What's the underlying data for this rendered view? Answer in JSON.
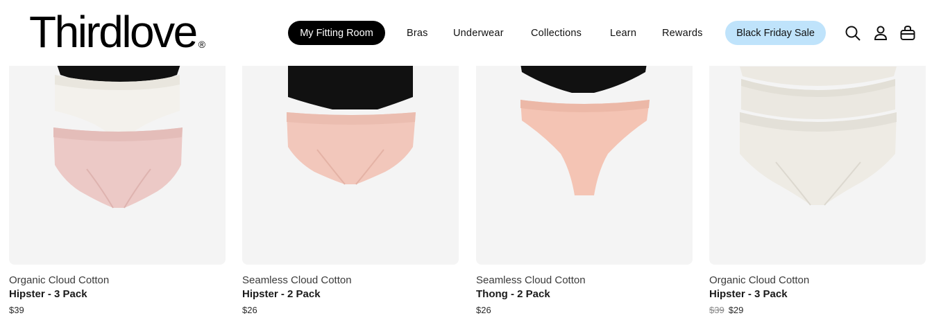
{
  "header": {
    "logo": "Thirdlove",
    "logo_mark": "®",
    "nav": {
      "fitting_room": "My Fitting Room",
      "bras": "Bras",
      "underwear": "Underwear",
      "collections": "Collections",
      "learn": "Learn",
      "rewards": "Rewards",
      "black_friday": "Black Friday Sale"
    },
    "icons": [
      "search-icon",
      "account-icon",
      "cart-icon"
    ]
  },
  "products": [
    {
      "collection": "Organic Cloud Cotton",
      "name": "Hipster - 3 Pack",
      "price": "$39",
      "colors": [
        "#111111",
        "#f3f1ec",
        "#ecc9c6"
      ]
    },
    {
      "collection": "Seamless Cloud Cotton",
      "name": "Hipster - 2 Pack",
      "price": "$26",
      "colors": [
        "#111111",
        "#f2c7bb"
      ]
    },
    {
      "collection": "Seamless Cloud Cotton",
      "name": "Thong - 2 Pack",
      "price": "$26",
      "colors": [
        "#111111",
        "#f4c4b4"
      ]
    },
    {
      "collection": "Organic Cloud Cotton",
      "name": "Hipster - 3 Pack",
      "original_price": "$39",
      "price": "$29",
      "colors": [
        "#ece9e2",
        "#ece9e2",
        "#ece9e2"
      ]
    }
  ],
  "colors": {
    "image_bg": "#f4f4f4",
    "sale_pill": "#bfe3fb",
    "fitting_pill": "#000000"
  }
}
